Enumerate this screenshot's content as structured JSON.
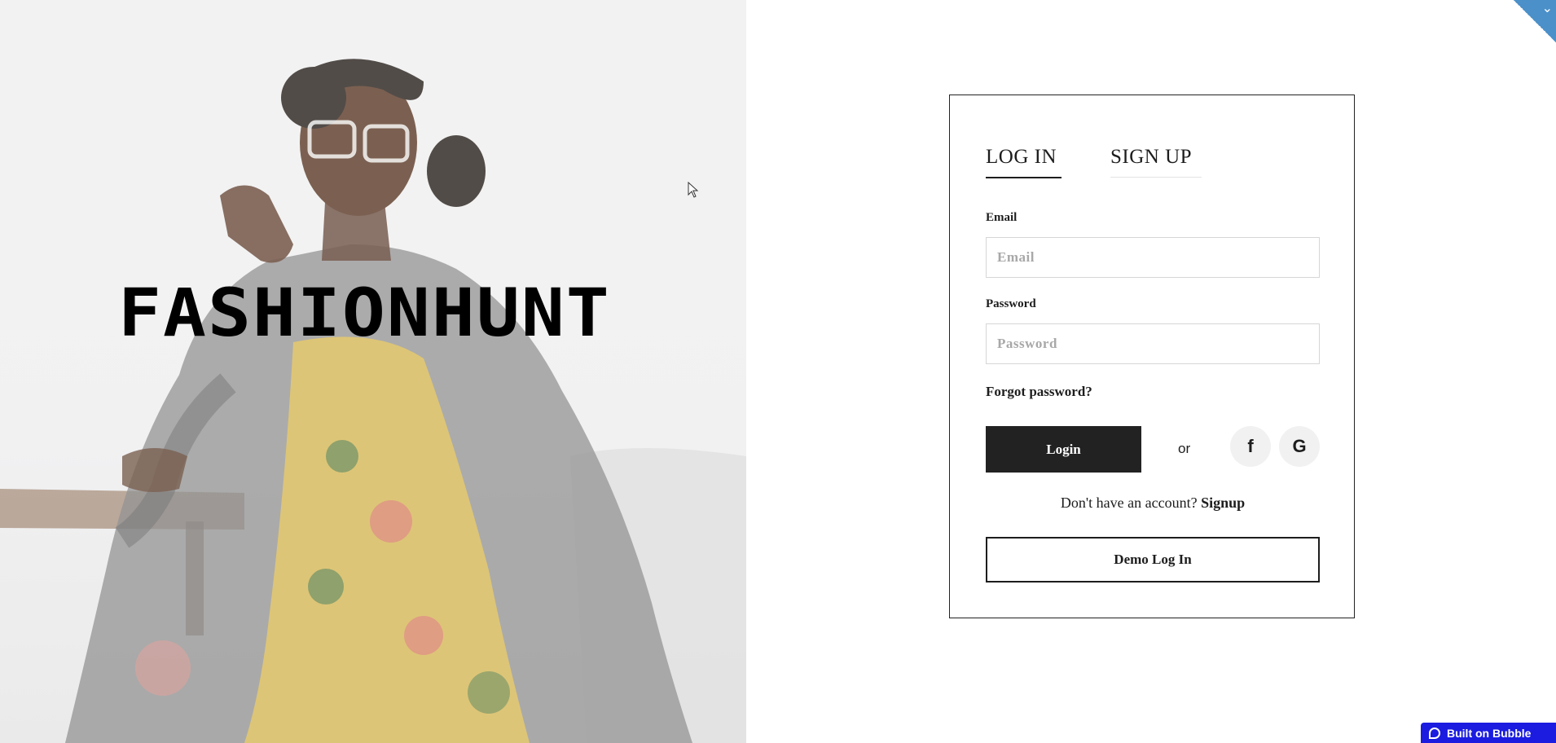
{
  "hero": {
    "brand": "FASHIONHUNT",
    "image_icon": "model-photo"
  },
  "auth": {
    "tabs": [
      {
        "label": "LOG IN",
        "active": true
      },
      {
        "label": "SIGN UP",
        "active": false
      }
    ],
    "email": {
      "label": "Email",
      "placeholder": "Email",
      "value": ""
    },
    "password": {
      "label": "Password",
      "placeholder": "Password",
      "value": ""
    },
    "forgot_label": "Forgot password?",
    "login_label": "Login",
    "or_label": "or",
    "social": {
      "facebook": "f",
      "google": "G"
    },
    "no_account_text": "Don't have an account?",
    "signup_link_label": "Signup",
    "demo_label": "Demo Log In"
  },
  "badge": {
    "label": "Built on Bubble"
  },
  "corner": {
    "icon": "chevron-down-icon",
    "glyph": "⌄"
  },
  "colors": {
    "primary": "#222222",
    "badge_blue": "#1b1ce0",
    "corner_blue": "#4b90c9"
  }
}
